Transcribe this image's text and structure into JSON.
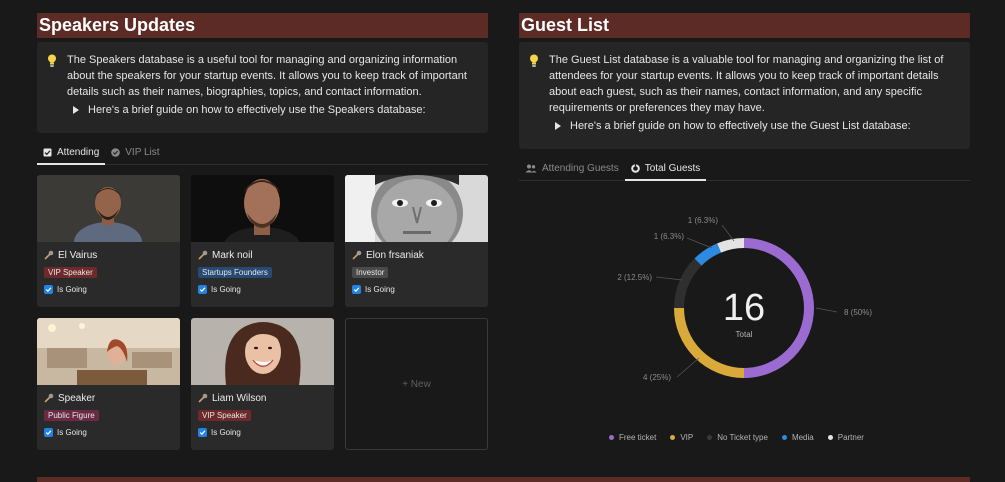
{
  "speakers": {
    "title": "Speakers Updates",
    "description": "The Speakers database is a useful tool for managing and organizing information about the speakers for your startup events. It allows you to keep track of important details such as their names, biographies, topics, and contact information.",
    "guide": "Here's a brief guide on how to effectively use the Speakers database:",
    "tabs": [
      {
        "label": "Attending",
        "icon": "checkbox-icon"
      },
      {
        "label": "VIP List",
        "icon": "check-circle-icon"
      }
    ],
    "going_label": "Is Going",
    "new_label": "+ New",
    "cards": [
      {
        "name": "El Vairus",
        "tag": "VIP Speaker",
        "tag_color": "#6e2a2a"
      },
      {
        "name": "Mark noil",
        "tag": "Startups Founders",
        "tag_color": "#264a72"
      },
      {
        "name": "Elon frsaniak",
        "tag": "Investor",
        "tag_color": "#4a4a4a"
      },
      {
        "name": "Speaker",
        "tag": "Public Figure",
        "tag_color": "#6b2a44"
      },
      {
        "name": "Liam Wilson",
        "tag": "VIP Speaker",
        "tag_color": "#6e2a2a"
      }
    ]
  },
  "guests": {
    "title": "Guest List",
    "description": "The Guest List database is a valuable tool for managing and organizing the list of attendees for your startup events. It allows you to keep track of important details about each guest, such as their names, contact information, and any specific requirements or preferences they may have.",
    "guide": "Here's a brief guide on how to effectively use the Guest List database:",
    "tabs": [
      {
        "label": "Attending Guests",
        "icon": "people-icon"
      },
      {
        "label": "Total Guests",
        "icon": "donut-icon"
      }
    ]
  },
  "colors": {
    "header": "#5c2b26",
    "free_ticket": "#9b6bd1",
    "vip": "#d9a93a",
    "no_ticket": "#2f2f2f",
    "media": "#2e8ae0",
    "partner": "#e3e3e3"
  },
  "chart_data": {
    "type": "pie",
    "total": "16",
    "total_label": "Total",
    "slices": [
      {
        "name": "Free ticket",
        "value": 8,
        "label": "8 (50%)"
      },
      {
        "name": "VIP",
        "value": 4,
        "label": "4 (25%)"
      },
      {
        "name": "No Ticket type",
        "value": 2,
        "label": "2 (12.5%)"
      },
      {
        "name": "Media",
        "value": 1,
        "label": "1 (6.3%)"
      },
      {
        "name": "Partner",
        "value": 1,
        "label": "1 (6.3%)"
      }
    ],
    "legend_position": "bottom"
  }
}
